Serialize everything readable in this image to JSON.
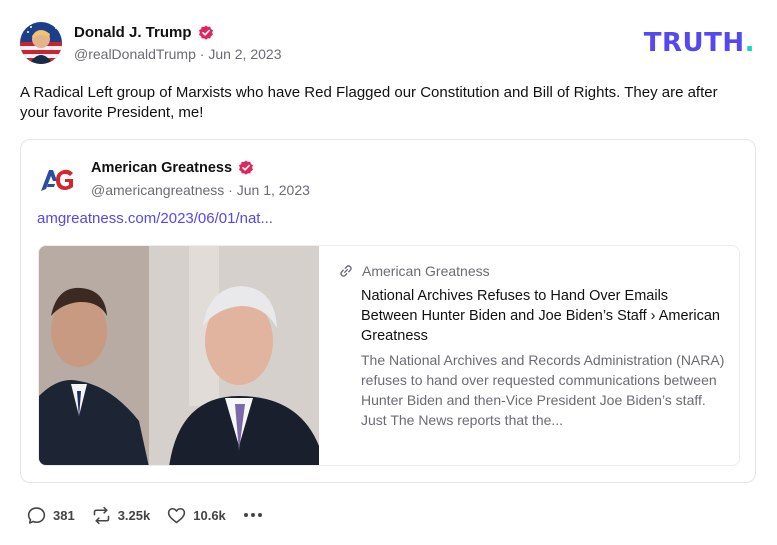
{
  "post": {
    "author_name": "Donald J. Trump",
    "handle": "@realDonaldTrump",
    "separator": "·",
    "date": "Jun 2, 2023",
    "text": "A Radical Left group of Marxists who have Red Flagged our Constitution and Bill of Rights. They are after your favorite President, me!"
  },
  "brand": {
    "main": "TRUTH",
    "dot": ".",
    "main_color": "#5448ee",
    "dot_color": "#0fd8b4"
  },
  "quote": {
    "author_name": "American Greatness",
    "handle": "@americangreatness",
    "separator": "·",
    "date": "Jun 1, 2023",
    "link_text": "amgreatness.com/2023/06/01/nat...",
    "card": {
      "source": "American Greatness",
      "title": "National Archives Refuses to Hand Over Emails Between Hunter Biden and Joe Biden’s Staff › American Greatness",
      "description": "The National Archives and Records Administration (NARA) refuses to hand over requested communications between Hunter Biden and then-Vice President Joe Biden’s staff. Just The News reports that the..."
    }
  },
  "actions": {
    "replies": "381",
    "retruths": "3.25k",
    "likes": "10.6k"
  },
  "colors": {
    "accent": "#5448ee",
    "verified": "#e0245e",
    "muted": "#6b6b76"
  },
  "icons": [
    "verified-badge-icon",
    "reply-icon",
    "retruth-icon",
    "heart-icon",
    "more-icon",
    "link-icon"
  ]
}
